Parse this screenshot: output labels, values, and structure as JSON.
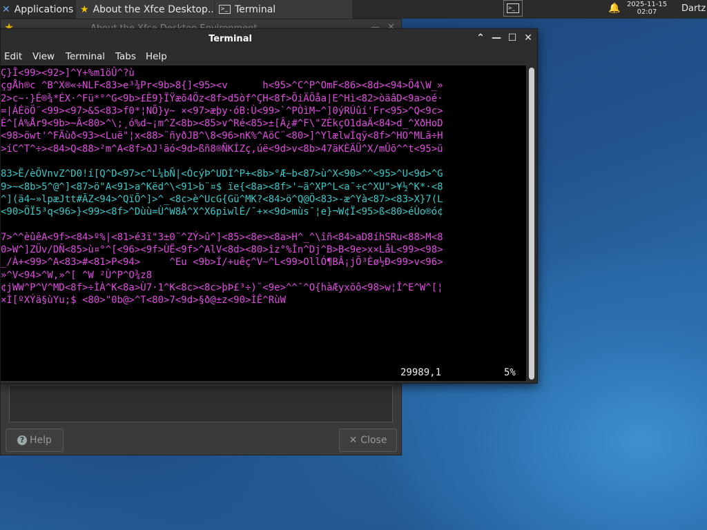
{
  "panel": {
    "apps_label": "Applications",
    "tasks": [
      {
        "label": "About the Xfce Desktop..."
      },
      {
        "label": "Terminal"
      }
    ],
    "clock_date": "2025-11-15",
    "clock_time": "02:07",
    "user": "Dartz"
  },
  "about_window": {
    "title": "About the Xfce Desktop Environment",
    "help_label": "Help",
    "close_label": "Close"
  },
  "terminal": {
    "title": "Terminal",
    "menu": [
      "Edit",
      "View",
      "Terminal",
      "Tabs",
      "Help"
    ],
    "lines": [
      {
        "text": "Ç}Î<99><92>]^Y+%m1öÛ^?ù",
        "color": "mg"
      },
      {
        "text": "çgÅh®c ^B^X®«÷NLF<83>e³¾Pr<9b>8{]<95><v      h<95>^C^P^OmF<86><8d><94>Ö4\\W_»",
        "color": "mg"
      },
      {
        "text": "2>c~·}É®¾*ÉX·^Fü*°^G<9b>£È9}ÏŸæõ4Öz<8f>d5òf^ÇH<8f>ÕiÄÖåa|E^Hì<82>òäâD<9a>oé·",
        "color": "mg"
      },
      {
        "text": "=|ÁÉöÖ¨<99><97>&S<83>f0*¦NÕ}y~ ×<97>æþy·óB:Ù<99>`^PÒìM~^]0ýRÚûí'Fr<95>^Q<9c>",
        "color": "mg"
      },
      {
        "text": "È^[À%År9<9b>~Ã<80>^\\;¸ó%d~¡m^Z<8b><85>v^Ré<85>±[Â¿#^F\\\"ZÈkçO1daÄ<84>d_^XðHoD",
        "color": "mg"
      },
      {
        "text": "<98>öwt'^FÄùð<93><Luë\"¦x<88>¨ñyðJB^\\8<96>nK%^AöC¨<80>]^YlælwÍqÿ<8f>^HO^MLã÷H",
        "color": "mg"
      },
      {
        "text": ">íC^T^÷><84>Q<88>²m^A<8f>ðJ¹äó<9d>ßñ8®ÑKÍZç,úë<9d>v<8b>47äKÈÄÜ^X/mÛõ^^t<95>ü",
        "color": "mg"
      },
      {
        "text": "",
        "color": "wh"
      },
      {
        "text": "83>Ë/èÕVnvZ^D0!í[Q^D<97>c^L¼bÑ|<ÓcýÞ^UDÌ^P+<8b>°Æ~b<87>ù^X<90>^^<95>^U<9d>^G",
        "color": "cy"
      },
      {
        "text": "9>~<8b>5^@^]<87>ö\"A<91>a^Këd^\\<91>b¨¤$ ïe{<8a><8f>'~ä^XP^L<a¯÷c^XU\">¥½^K*·<8",
        "color": "cy"
      },
      {
        "text": "^](ä4~»lpæJtt#ÃZ<94>^QïÕ^]>^_<8c>è^UcG{Gü^MK?<84>ö^Q@Ö<83>-æ^Yà<87><83>X}7(L",
        "color": "cy"
      },
      {
        "text": "<90>ÖÏ5³q<96>}<99><8f>^Dùù=Ù^W8À^X^X6piwlÈ/¯+×<9d>mùs¯¦e}¬W¢Ï<95>ß<80>éÙo®ó¢",
        "color": "cy"
      },
      {
        "text": "",
        "color": "wh"
      },
      {
        "text": "7>^^èûêA<9f><84>º%|<81>é3ï\"3±0¨^ZÝ>û^]<85><8e><8a>H^_^\\îñ<84>aD8íhSRu<88>M<8",
        "color": "mg"
      },
      {
        "text": "0>W^]ZÜv/DÑ<85>ù¤°^[<96><9f>ÙË<9f>^AlV<8d><80>îz°%În^Dj^B>B<9e>x×LåL<99><98>",
        "color": "mg"
      },
      {
        "text": "_/À+<99>^A<83>#<81>P<94>     ^Eu <9b>Í/+uêç^V~^L<99>OllÓ¶BÂ¡jÕ³Èø½Ð<99>v<96>",
        "color": "mg"
      },
      {
        "text": "»^V<94>^W,»^[ ^W ²Ù^P^O¾z8",
        "color": "mg"
      },
      {
        "text": "¢jWW^P^V^MD<8f>÷ÌÀ^K<8a>Ù7·1^K<8c><8c>þÞ£³÷)¨<9e>^^¯^O{hàÆyxõô<98>w¦Î^E^W^[¦",
        "color": "mg"
      },
      {
        "text": "×Ì[ºXÝä§ùYu;$ <80>\"0b@>^T<80>7<9d>§ð@±z<90>ÌÊ^RùW",
        "color": "mg"
      }
    ],
    "status_position": "29989,1",
    "status_percent": "5%"
  }
}
